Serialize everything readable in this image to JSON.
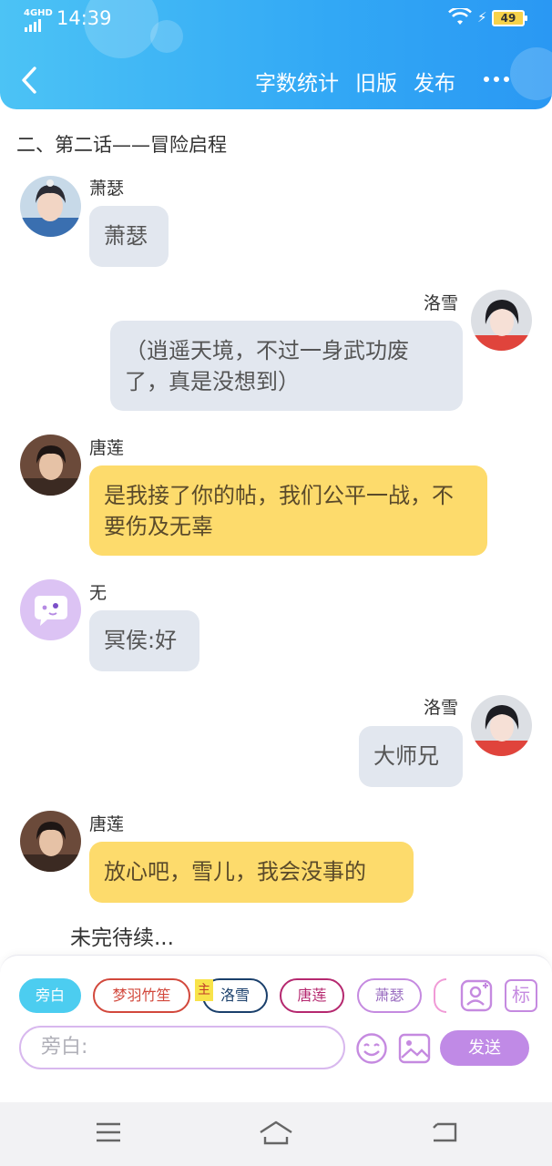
{
  "status_bar": {
    "network": "4GHD",
    "time": "14:39",
    "battery": "49"
  },
  "header": {
    "actions": [
      "字数统计",
      "旧版",
      "发布"
    ]
  },
  "chapter_title": "二、第二话——冒险启程",
  "messages": [
    {
      "speaker": "萧瑟",
      "text": "萧瑟"
    },
    {
      "speaker": "洛雪",
      "text": "（逍遥天境，不过一身武功废了，真是没想到）"
    },
    {
      "speaker": "唐莲",
      "text": "是我接了你的帖，我们公平一战，不要伤及无辜"
    },
    {
      "speaker": "无",
      "text": "冥侯:好"
    },
    {
      "speaker": "洛雪",
      "text": "大师兄"
    },
    {
      "speaker": "唐莲",
      "text": "放心吧，雪儿，我会没事的"
    }
  ],
  "continued_text": "未完待续...",
  "colors": {
    "header": "#32a8f5",
    "gray_bubble": "#e2e7ef",
    "yellow_bubble": "#fddb6c",
    "send": "#c08ae6"
  },
  "roles": {
    "chips": [
      {
        "label": "旁白",
        "color": "#4ccdf0"
      },
      {
        "label": "梦羽竹笙",
        "color": "#d2483c"
      },
      {
        "label": "洛雪",
        "color": "#1a3f6b"
      },
      {
        "label": "唐莲",
        "color": "#b5286f"
      },
      {
        "label": "萧瑟",
        "color": "#c58ae0"
      }
    ],
    "main_tag": "主",
    "mark_label": "标"
  },
  "composer": {
    "placeholder": "旁白:",
    "send_label": "发送"
  }
}
